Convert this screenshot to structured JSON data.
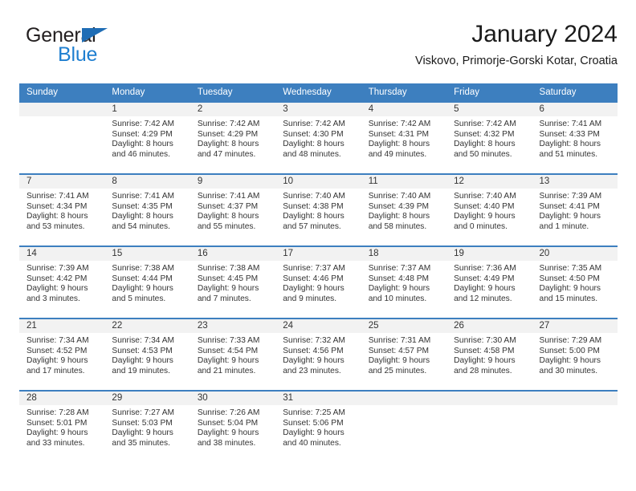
{
  "brand": {
    "name_part1": "General",
    "name_part2": "Blue",
    "flag_icon": "triangle-flag-icon",
    "accent_color": "#1f7fd0"
  },
  "header": {
    "title": "January 2024",
    "subtitle": "Viskovo, Primorje-Gorski Kotar, Croatia"
  },
  "calendar": {
    "header_bg_color": "#3d7fbf",
    "day_header_bg_color": "#f2f2f2",
    "weekdays": [
      "Sunday",
      "Monday",
      "Tuesday",
      "Wednesday",
      "Thursday",
      "Friday",
      "Saturday"
    ],
    "weeks": [
      [
        {
          "day": "",
          "sunrise": "",
          "sunset": "",
          "daylight": "",
          "empty": true
        },
        {
          "day": "1",
          "sunrise": "Sunrise: 7:42 AM",
          "sunset": "Sunset: 4:29 PM",
          "daylight": "Daylight: 8 hours and 46 minutes."
        },
        {
          "day": "2",
          "sunrise": "Sunrise: 7:42 AM",
          "sunset": "Sunset: 4:29 PM",
          "daylight": "Daylight: 8 hours and 47 minutes."
        },
        {
          "day": "3",
          "sunrise": "Sunrise: 7:42 AM",
          "sunset": "Sunset: 4:30 PM",
          "daylight": "Daylight: 8 hours and 48 minutes."
        },
        {
          "day": "4",
          "sunrise": "Sunrise: 7:42 AM",
          "sunset": "Sunset: 4:31 PM",
          "daylight": "Daylight: 8 hours and 49 minutes."
        },
        {
          "day": "5",
          "sunrise": "Sunrise: 7:42 AM",
          "sunset": "Sunset: 4:32 PM",
          "daylight": "Daylight: 8 hours and 50 minutes."
        },
        {
          "day": "6",
          "sunrise": "Sunrise: 7:41 AM",
          "sunset": "Sunset: 4:33 PM",
          "daylight": "Daylight: 8 hours and 51 minutes."
        }
      ],
      [
        {
          "day": "7",
          "sunrise": "Sunrise: 7:41 AM",
          "sunset": "Sunset: 4:34 PM",
          "daylight": "Daylight: 8 hours and 53 minutes."
        },
        {
          "day": "8",
          "sunrise": "Sunrise: 7:41 AM",
          "sunset": "Sunset: 4:35 PM",
          "daylight": "Daylight: 8 hours and 54 minutes."
        },
        {
          "day": "9",
          "sunrise": "Sunrise: 7:41 AM",
          "sunset": "Sunset: 4:37 PM",
          "daylight": "Daylight: 8 hours and 55 minutes."
        },
        {
          "day": "10",
          "sunrise": "Sunrise: 7:40 AM",
          "sunset": "Sunset: 4:38 PM",
          "daylight": "Daylight: 8 hours and 57 minutes."
        },
        {
          "day": "11",
          "sunrise": "Sunrise: 7:40 AM",
          "sunset": "Sunset: 4:39 PM",
          "daylight": "Daylight: 8 hours and 58 minutes."
        },
        {
          "day": "12",
          "sunrise": "Sunrise: 7:40 AM",
          "sunset": "Sunset: 4:40 PM",
          "daylight": "Daylight: 9 hours and 0 minutes."
        },
        {
          "day": "13",
          "sunrise": "Sunrise: 7:39 AM",
          "sunset": "Sunset: 4:41 PM",
          "daylight": "Daylight: 9 hours and 1 minute."
        }
      ],
      [
        {
          "day": "14",
          "sunrise": "Sunrise: 7:39 AM",
          "sunset": "Sunset: 4:42 PM",
          "daylight": "Daylight: 9 hours and 3 minutes."
        },
        {
          "day": "15",
          "sunrise": "Sunrise: 7:38 AM",
          "sunset": "Sunset: 4:44 PM",
          "daylight": "Daylight: 9 hours and 5 minutes."
        },
        {
          "day": "16",
          "sunrise": "Sunrise: 7:38 AM",
          "sunset": "Sunset: 4:45 PM",
          "daylight": "Daylight: 9 hours and 7 minutes."
        },
        {
          "day": "17",
          "sunrise": "Sunrise: 7:37 AM",
          "sunset": "Sunset: 4:46 PM",
          "daylight": "Daylight: 9 hours and 9 minutes."
        },
        {
          "day": "18",
          "sunrise": "Sunrise: 7:37 AM",
          "sunset": "Sunset: 4:48 PM",
          "daylight": "Daylight: 9 hours and 10 minutes."
        },
        {
          "day": "19",
          "sunrise": "Sunrise: 7:36 AM",
          "sunset": "Sunset: 4:49 PM",
          "daylight": "Daylight: 9 hours and 12 minutes."
        },
        {
          "day": "20",
          "sunrise": "Sunrise: 7:35 AM",
          "sunset": "Sunset: 4:50 PM",
          "daylight": "Daylight: 9 hours and 15 minutes."
        }
      ],
      [
        {
          "day": "21",
          "sunrise": "Sunrise: 7:34 AM",
          "sunset": "Sunset: 4:52 PM",
          "daylight": "Daylight: 9 hours and 17 minutes."
        },
        {
          "day": "22",
          "sunrise": "Sunrise: 7:34 AM",
          "sunset": "Sunset: 4:53 PM",
          "daylight": "Daylight: 9 hours and 19 minutes."
        },
        {
          "day": "23",
          "sunrise": "Sunrise: 7:33 AM",
          "sunset": "Sunset: 4:54 PM",
          "daylight": "Daylight: 9 hours and 21 minutes."
        },
        {
          "day": "24",
          "sunrise": "Sunrise: 7:32 AM",
          "sunset": "Sunset: 4:56 PM",
          "daylight": "Daylight: 9 hours and 23 minutes."
        },
        {
          "day": "25",
          "sunrise": "Sunrise: 7:31 AM",
          "sunset": "Sunset: 4:57 PM",
          "daylight": "Daylight: 9 hours and 25 minutes."
        },
        {
          "day": "26",
          "sunrise": "Sunrise: 7:30 AM",
          "sunset": "Sunset: 4:58 PM",
          "daylight": "Daylight: 9 hours and 28 minutes."
        },
        {
          "day": "27",
          "sunrise": "Sunrise: 7:29 AM",
          "sunset": "Sunset: 5:00 PM",
          "daylight": "Daylight: 9 hours and 30 minutes."
        }
      ],
      [
        {
          "day": "28",
          "sunrise": "Sunrise: 7:28 AM",
          "sunset": "Sunset: 5:01 PM",
          "daylight": "Daylight: 9 hours and 33 minutes."
        },
        {
          "day": "29",
          "sunrise": "Sunrise: 7:27 AM",
          "sunset": "Sunset: 5:03 PM",
          "daylight": "Daylight: 9 hours and 35 minutes."
        },
        {
          "day": "30",
          "sunrise": "Sunrise: 7:26 AM",
          "sunset": "Sunset: 5:04 PM",
          "daylight": "Daylight: 9 hours and 38 minutes."
        },
        {
          "day": "31",
          "sunrise": "Sunrise: 7:25 AM",
          "sunset": "Sunset: 5:06 PM",
          "daylight": "Daylight: 9 hours and 40 minutes."
        },
        {
          "day": "",
          "sunrise": "",
          "sunset": "",
          "daylight": "",
          "empty": true
        },
        {
          "day": "",
          "sunrise": "",
          "sunset": "",
          "daylight": "",
          "empty": true
        },
        {
          "day": "",
          "sunrise": "",
          "sunset": "",
          "daylight": "",
          "empty": true
        }
      ]
    ]
  }
}
